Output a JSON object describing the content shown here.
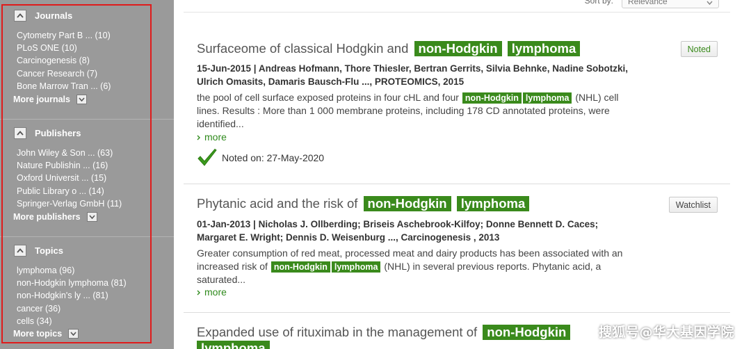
{
  "sidebar": {
    "journals": {
      "title": "Journals",
      "items": [
        "Cytometry Part B ... (10)",
        "PLoS ONE (10)",
        "Carcinogenesis (8)",
        "Cancer Research (7)",
        "Bone Marrow Tran ... (6)"
      ],
      "more_label": "More journals"
    },
    "publishers": {
      "title": "Publishers",
      "items": [
        "John Wiley & Son ... (63)",
        "Nature Publishin ... (16)",
        "Oxford Universit ... (15)",
        "Public Library o ... (14)",
        "Springer-Verlag GmbH (11)"
      ],
      "more_label": "More publishers"
    },
    "topics": {
      "title": "Topics",
      "items": [
        "lymphoma (96)",
        "non-Hodgkin lymphoma (81)",
        "non-Hodgkin's ly ... (81)",
        "cancer (36)",
        "cells (34)"
      ],
      "more_label": "More topics"
    }
  },
  "sort": {
    "label": "Sort by:",
    "value": "Relevance"
  },
  "results": [
    {
      "title_prefix": "Surfaceome of classical Hodgkin and",
      "hl1": "non-Hodgkin",
      "hl2": "lymphoma",
      "meta_line1": "15-Jun-2015 | Andreas Hofmann, Thore Thiesler, Bertran Gerrits, Silvia Behnke, Nadine Sobotzki,",
      "meta_line2": "Ulrich Omasits, Damaris Bausch-Flu ..., PROTEOMICS, 2015",
      "snippet_a": "the pool of cell surface exposed proteins in four cHL and four",
      "snippet_b": "(NHL) cell",
      "snippet_c": "lines. Results : More than 1 000 membrane proteins, including 178 CD annotated proteins, were",
      "snippet_d": "identified...",
      "more": "more",
      "button": "Noted",
      "noted_on": "Noted on: 27-May-2020"
    },
    {
      "title_prefix": "Phytanic acid and the risk of",
      "hl1": "non-Hodgkin",
      "hl2": "lymphoma",
      "meta_line1": "01-Jan-2013 | Nicholas J. Ollberding; Briseis Aschebrook-Kilfoy; Donne Bennett D. Caces;",
      "meta_line2": "Margaret E. Wright; Dennis D. Weisenburg ..., Carcinogenesis , 2013",
      "snippet_a": "Greater consumption of red meat, processed meat and dairy products has been associated with an",
      "snippet_b": "increased risk of",
      "snippet_c": "(NHL) in several previous reports. Phytanic acid, a",
      "snippet_d": "saturated...",
      "more": "more",
      "button": "Watchlist"
    },
    {
      "title_prefix": "Expanded use of rituximab in the management of",
      "hl1": "non-Hodgkin",
      "hl2": "lymphoma"
    }
  ],
  "watermark": "搜狐号@华大基因学院",
  "colors": {
    "highlight": "#3a8a1c",
    "sidebar_bg": "#9a9a9a",
    "outline": "#e01b1b",
    "link": "#2f8a1c"
  }
}
